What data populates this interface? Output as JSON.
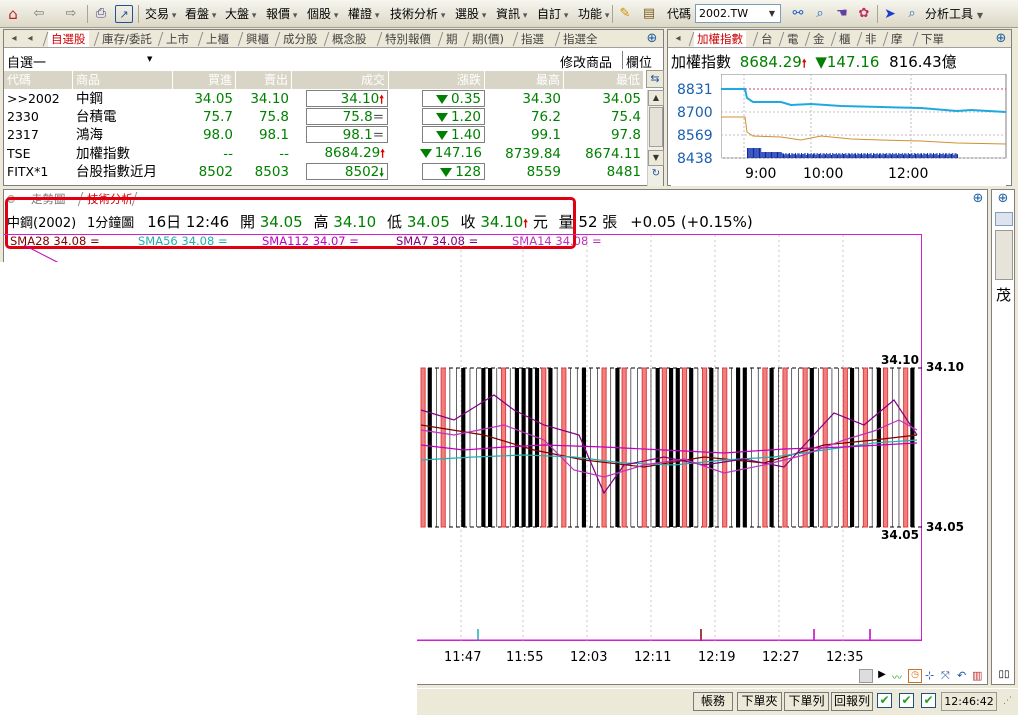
{
  "toolbar": {
    "menus": [
      {
        "label": "交易",
        "x": 145
      },
      {
        "label": "看盤",
        "x": 185
      },
      {
        "label": "大盤",
        "x": 225
      },
      {
        "label": "報價",
        "x": 266
      },
      {
        "label": "個股",
        "x": 307
      },
      {
        "label": "權證",
        "x": 348
      },
      {
        "label": "技術分析",
        "x": 390
      },
      {
        "label": "選股",
        "x": 455
      },
      {
        "label": "資訊",
        "x": 496
      },
      {
        "label": "自訂",
        "x": 537
      },
      {
        "label": "功能",
        "x": 578
      }
    ],
    "code_label": "代碼",
    "code_value": "2002.TW",
    "analysis_tools": "分析工具"
  },
  "watchlist": {
    "tabs": [
      "自選股",
      "庫存/委託",
      "上市",
      "上櫃",
      "興櫃",
      "成分股",
      "概念股",
      "特別報價",
      "期",
      "期(價)",
      "指選",
      "指選全"
    ],
    "group_name": "自選一",
    "modify_label": "修改商品",
    "column_label": "欄位",
    "headers": [
      "代碼",
      "商品",
      "買進",
      "賣出",
      "成交",
      "漲跌",
      "最高",
      "最低"
    ],
    "rows": [
      {
        "code": ">>2002",
        "name": "中鋼",
        "bid": "34.05",
        "ask": "34.10",
        "last": "34.10",
        "last_dir": "up",
        "change": "0.35",
        "change_dir": "down",
        "high": "34.30",
        "low": "34.05"
      },
      {
        "code": "2330",
        "name": "台積電",
        "bid": "75.7",
        "ask": "75.8",
        "last": "75.8",
        "last_dir": "flat",
        "change": "1.20",
        "change_dir": "down",
        "high": "76.2",
        "low": "75.4"
      },
      {
        "code": "2317",
        "name": "鴻海",
        "bid": "98.0",
        "ask": "98.1",
        "last": "98.1",
        "last_dir": "flat",
        "change": "1.40",
        "change_dir": "down",
        "high": "99.1",
        "low": "97.8"
      },
      {
        "code": "TSE",
        "name": "加權指數",
        "bid": "--",
        "ask": "--",
        "last": "8684.29",
        "last_dir": "up",
        "change": "147.16",
        "change_dir": "down",
        "high": "8739.84",
        "low": "8674.11"
      },
      {
        "code": "FITX*1",
        "name": "台股指數近月",
        "bid": "8502",
        "ask": "8503",
        "last": "8502",
        "last_dir": "down",
        "change": "128",
        "change_dir": "down",
        "high": "8559",
        "low": "8481"
      }
    ]
  },
  "index_panel": {
    "tabs": [
      "加權指數",
      "台",
      "電",
      "金",
      "櫃",
      "非",
      "摩",
      "下單"
    ],
    "name": "加權指數",
    "value": "8684.29",
    "change": "147.16",
    "volume": "816.43億",
    "y_labels": [
      "8831",
      "8700",
      "8569",
      "8438"
    ],
    "x_labels": [
      "9:00",
      "10:00",
      "12:00"
    ]
  },
  "chart": {
    "tabs": [
      "走勢圖",
      "技術分析"
    ],
    "stock": "中鋼(2002)",
    "interval": "1分鐘圖",
    "date": "16日 12:46",
    "open_label": "開",
    "open": "34.05",
    "high_label": "高",
    "high": "34.10",
    "low_label": "低",
    "low": "34.05",
    "close_label": "收",
    "close": "34.10",
    "unit": "元",
    "vol_label": "量",
    "vol": "52",
    "vol_unit": "張",
    "change": "+0.05 (+0.15%)",
    "sma": [
      {
        "text": "SMA28 34.08 =",
        "color": "#800000"
      },
      {
        "text": "SMA56 34.08 =",
        "color": "#20b0b0"
      },
      {
        "text": "SMA112 34.07 =",
        "color": "#c000c0"
      },
      {
        "text": "SMA7 34.08 =",
        "color": "#800080"
      },
      {
        "text": "SMA14 34.08 =",
        "color": "#c030c0"
      }
    ],
    "price_top": "34.10",
    "price_bottom": "34.05",
    "axis_top": "34.10",
    "axis_bottom": "34.05",
    "time_labels": [
      "11:47",
      "11:55",
      "12:03",
      "12:11",
      "12:19",
      "12:27",
      "12:35"
    ],
    "side_char": "茂"
  },
  "chart_data": {
    "type": "bar",
    "categories": [
      "11:47",
      "11:55",
      "12:03",
      "12:11",
      "12:19",
      "12:27",
      "12:35"
    ],
    "ylim": [
      34.05,
      34.1
    ],
    "bar_pattern": [
      0,
      1,
      0,
      0,
      0,
      0,
      1,
      0,
      0,
      1,
      1,
      0,
      0,
      0,
      1,
      1,
      1,
      1,
      0,
      1,
      0,
      0,
      0,
      0,
      1,
      0,
      0,
      0,
      0,
      1,
      0,
      0,
      0,
      0,
      0,
      1,
      0,
      1,
      1,
      0,
      1,
      0,
      0,
      1,
      0,
      0,
      0,
      1,
      1,
      0,
      0,
      0,
      1,
      0,
      0,
      0,
      0,
      0,
      1,
      0,
      0,
      0,
      0,
      0,
      1,
      0,
      0,
      0,
      1,
      0,
      0,
      0,
      0,
      1
    ],
    "series": [
      {
        "name": "SMA28",
        "color": "#800000"
      },
      {
        "name": "SMA56",
        "color": "#20b0b0"
      },
      {
        "name": "SMA112",
        "color": "#c000c0"
      },
      {
        "name": "SMA7",
        "color": "#800080"
      },
      {
        "name": "SMA14",
        "color": "#c030c0"
      }
    ]
  },
  "status": {
    "buttons": [
      "帳務",
      "下單夾",
      "下單列",
      "回報列"
    ],
    "time": "12:46:42"
  },
  "colors": {
    "up": "#e00000",
    "down": "#008000",
    "highlight": "#d00000"
  }
}
